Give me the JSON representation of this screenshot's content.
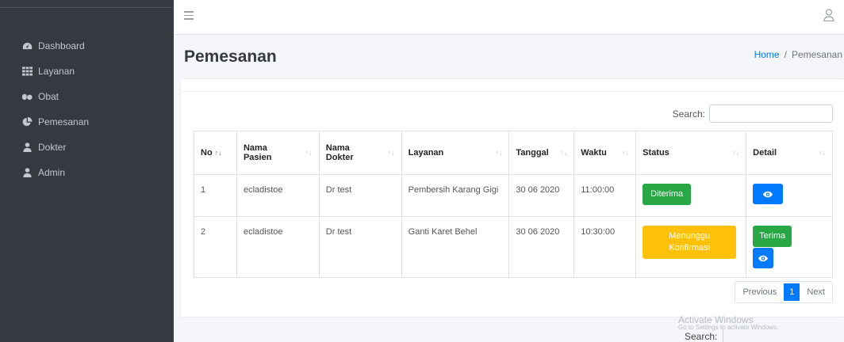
{
  "sidebar": {
    "items": [
      {
        "label": "Dashboard",
        "icon": "tachometer-icon"
      },
      {
        "label": "Layanan",
        "icon": "grid-icon"
      },
      {
        "label": "Obat",
        "icon": "pills-icon"
      },
      {
        "label": "Pemesanan",
        "icon": "pie-chart-icon"
      },
      {
        "label": "Dokter",
        "icon": "user-md-icon"
      },
      {
        "label": "Admin",
        "icon": "user-icon"
      }
    ]
  },
  "topbar": {
    "menu_icon": "hamburger-icon",
    "user_icon": "user-outline-icon"
  },
  "header": {
    "title": "Pemesanan",
    "breadcrumb": {
      "home": "Home",
      "separator": "/",
      "current": "Pemesanan"
    }
  },
  "table": {
    "search_label": "Search:",
    "columns": [
      {
        "label": "No",
        "sort": "↑↓"
      },
      {
        "label": "Nama Pasien",
        "sort": "↑↓"
      },
      {
        "label": "Nama Dokter",
        "sort": "↑↓"
      },
      {
        "label": "Layanan",
        "sort": "↑↓"
      },
      {
        "label": "Tanggal",
        "sort": "↑↓"
      },
      {
        "label": "Waktu",
        "sort": "↑↓"
      },
      {
        "label": "Status",
        "sort": "↑↓"
      },
      {
        "label": "Detail",
        "sort": "↑↓"
      }
    ],
    "rows": [
      {
        "no": "1",
        "pasien": "ecladistoe",
        "dokter": "Dr test",
        "layanan": "Pembersih Karang Gigi",
        "tanggal": "30 06 2020",
        "waktu": "11:00:00",
        "status": "Diterima",
        "action": ""
      },
      {
        "no": "2",
        "pasien": "ecladistoe",
        "dokter": "Dr test",
        "layanan": "Ganti Karet Behel",
        "tanggal": "30 06 2020",
        "waktu": "10:30:00",
        "status": "Menunggu Konfirmasi",
        "action": "Terima"
      }
    ]
  },
  "pagination": {
    "previous": "Previous",
    "current": "1",
    "next": "Next"
  },
  "watermark": {
    "line1": "Activate Windows",
    "line2": "Go to Settings to activate Windows."
  },
  "bottom_search_label": "Search:",
  "colors": {
    "sidebar": "#343a40",
    "primary": "#007bff",
    "success": "#28a745",
    "warning": "#ffc107"
  }
}
